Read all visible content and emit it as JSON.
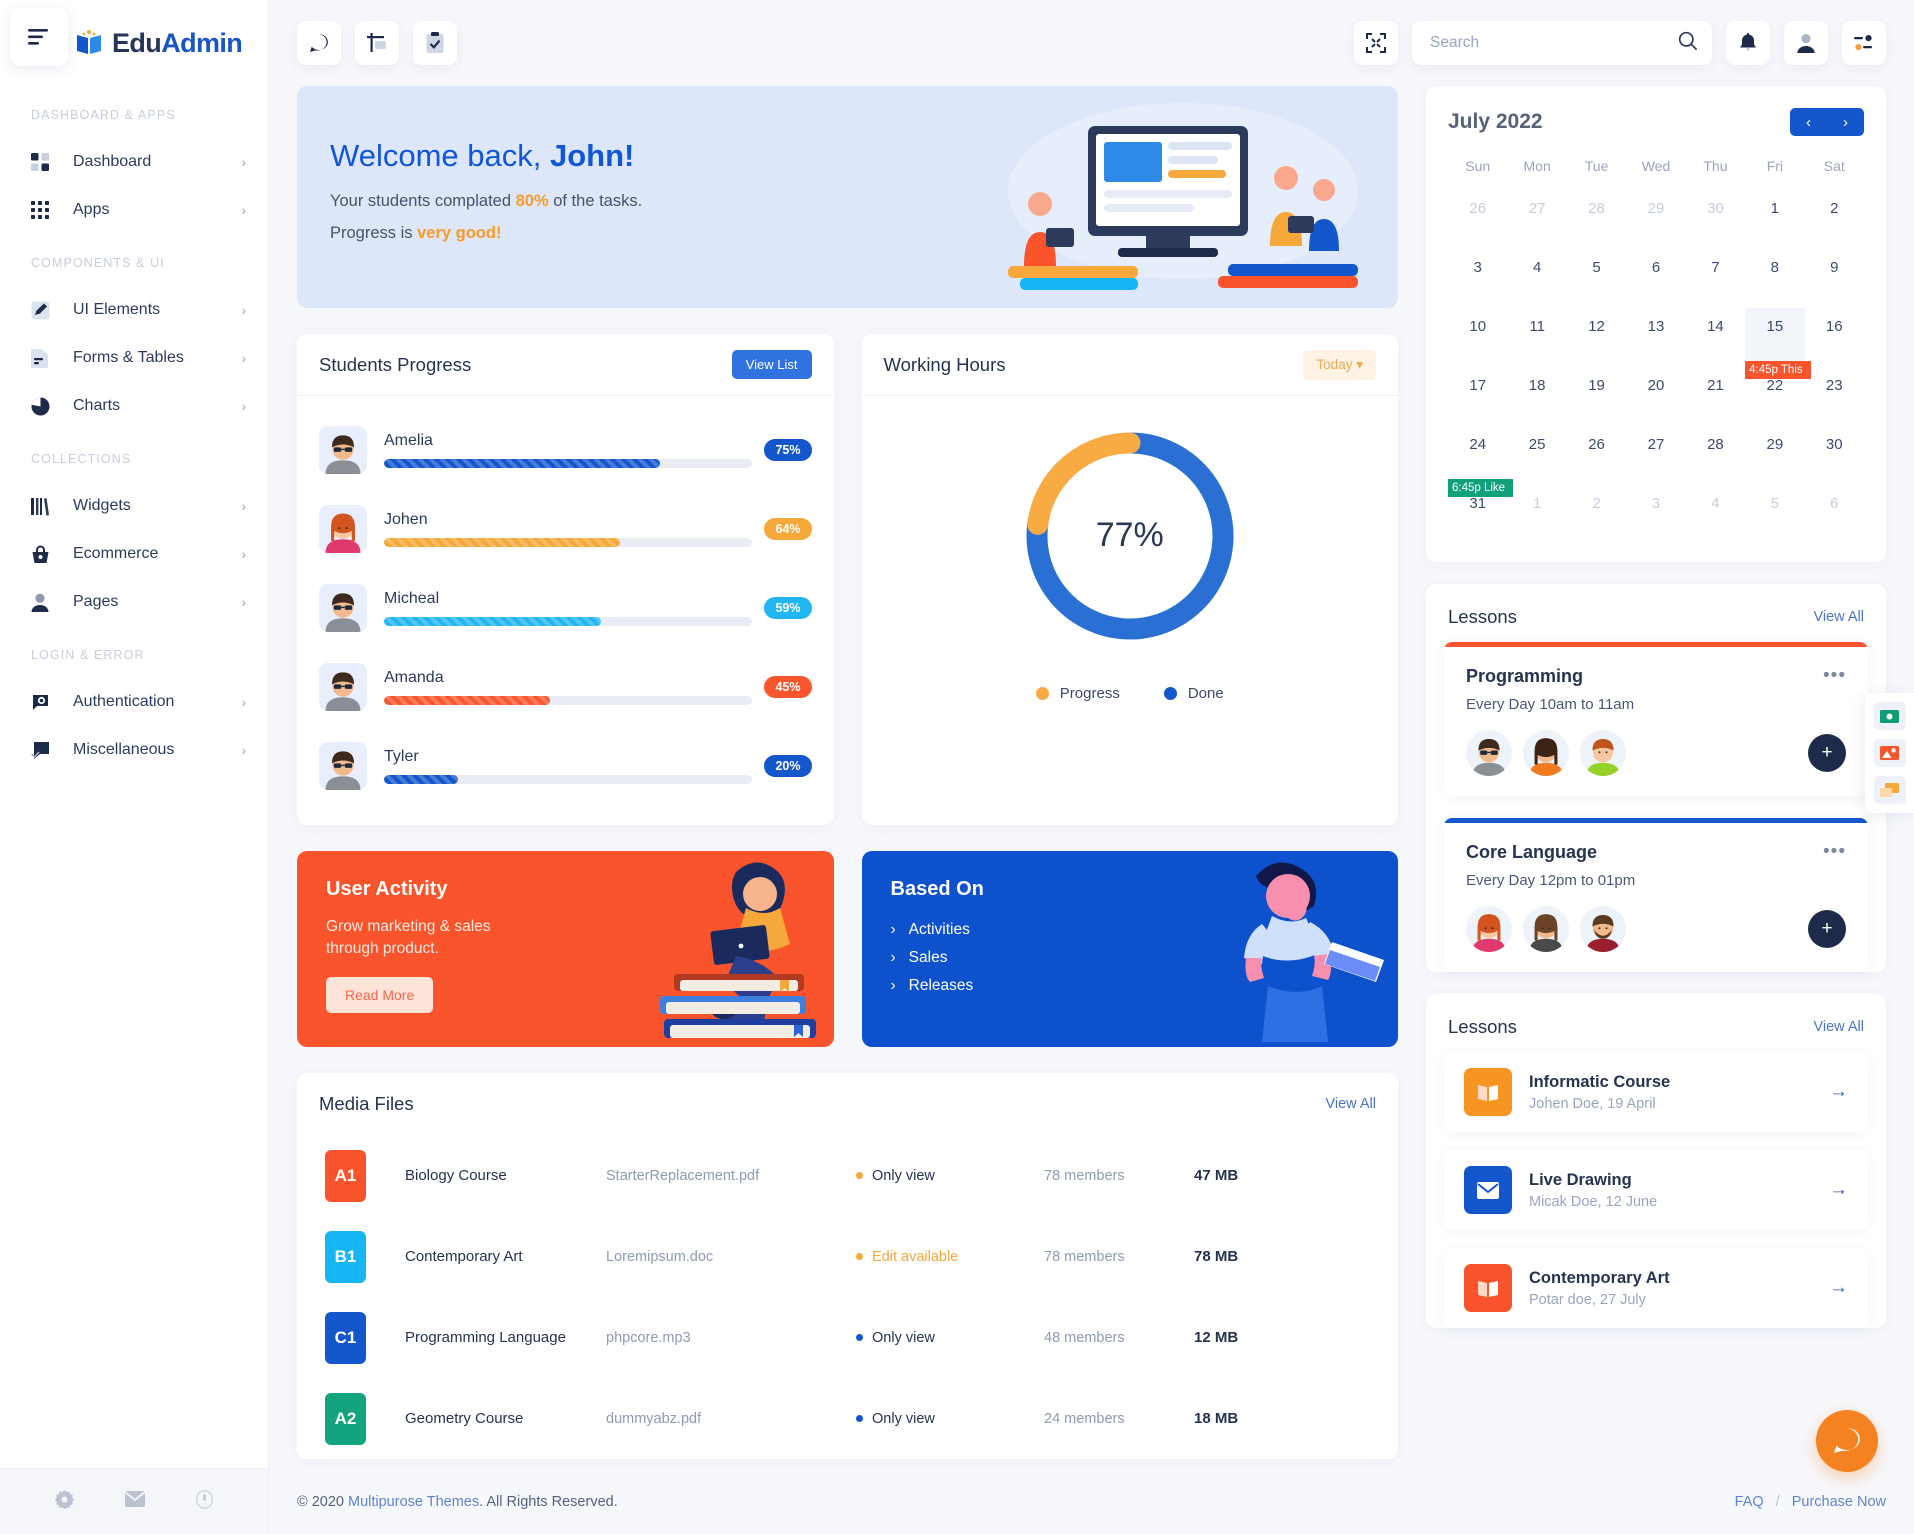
{
  "brand": {
    "name_part1": "Edu",
    "name_part2": "Admin",
    "logo_icon": "open-book-icon"
  },
  "sidebar": {
    "toggle_icon": "menu-toggle-icon",
    "groups": [
      {
        "heading": "DASHBOARD & APPS",
        "items": [
          {
            "label": "Dashboard",
            "icon": "grid-squares-icon"
          },
          {
            "label": "Apps",
            "icon": "apps-dots-icon"
          }
        ]
      },
      {
        "heading": "COMPONENTS & UI",
        "items": [
          {
            "label": "UI Elements",
            "icon": "pencil-square-icon"
          },
          {
            "label": "Forms & Tables",
            "icon": "document-icon"
          },
          {
            "label": "Charts",
            "icon": "pie-chart-icon"
          }
        ]
      },
      {
        "heading": "COLLECTIONS",
        "items": [
          {
            "label": "Widgets",
            "icon": "books-icon"
          },
          {
            "label": "Ecommerce",
            "icon": "basket-icon"
          },
          {
            "label": "Pages",
            "icon": "user-icon"
          }
        ]
      },
      {
        "heading": "LOGIN & ERROR",
        "items": [
          {
            "label": "Authentication",
            "icon": "lock-icon"
          },
          {
            "label": "Miscellaneous",
            "icon": "flag-check-icon"
          }
        ]
      }
    ],
    "footer_icons": [
      "gear-icon",
      "mail-icon",
      "power-lock-icon"
    ]
  },
  "topbar": {
    "left_icons": [
      "chat-bubble-icon",
      "layout-icon",
      "clipboard-check-icon"
    ],
    "fullscreen_icon": "fullscreen-icon",
    "search": {
      "placeholder": "Search",
      "value": "",
      "icon": "search-icon"
    },
    "right_icons": [
      "bell-icon",
      "user-avatar-icon",
      "settings-sliders-icon"
    ]
  },
  "welcome": {
    "title_prefix": "Welcome back, ",
    "title_name": "John!",
    "line1_pre": "Your students complated ",
    "line1_hl": "80%",
    "line1_post": " of the tasks.",
    "line2_pre": "Progress is ",
    "line2_hl": "very good!"
  },
  "students_progress": {
    "title": "Students Progress",
    "button": "View List",
    "rows": [
      {
        "name": "Amelia",
        "percent": 75,
        "label": "75%",
        "color": "#1457cc",
        "avatar": "man-sunglasses-avatar"
      },
      {
        "name": "Johen",
        "percent": 64,
        "label": "64%",
        "color": "#f7a83a",
        "avatar": "woman-redhair-avatar"
      },
      {
        "name": "Micheal",
        "percent": 59,
        "label": "59%",
        "color": "#22b6f2",
        "avatar": "man-sunglasses-avatar"
      },
      {
        "name": "Amanda",
        "percent": 45,
        "label": "45%",
        "color": "#f9562e",
        "avatar": "man-sunglasses-avatar"
      },
      {
        "name": "Tyler",
        "percent": 20,
        "label": "20%",
        "color": "#1457cc",
        "avatar": "man-sunglasses-avatar"
      }
    ]
  },
  "chart_data": {
    "type": "pie",
    "title": "Working Hours",
    "center_label": "77%",
    "labels": [
      "Done",
      "Progress"
    ],
    "values": [
      77,
      23
    ],
    "colors": [
      "#2a6fd4",
      "#f9ab43"
    ],
    "legend_position": "bottom",
    "donut": true,
    "legend": [
      {
        "name": "Progress",
        "color": "#f9ab43",
        "value": 23
      },
      {
        "name": "Done",
        "color": "#1457cc",
        "value": 77
      }
    ],
    "filter_label": "Today"
  },
  "user_activity": {
    "title": "User Activity",
    "subtitle": "Grow marketing & sales through product.",
    "button": "Read More",
    "bg": "#f9542b"
  },
  "based_on": {
    "title": "Based On",
    "bg": "#0d52cc",
    "items": [
      "Activities",
      "Sales",
      "Releases"
    ]
  },
  "media_files": {
    "title": "Media Files",
    "view_all": "View All",
    "rows": [
      {
        "code": "A1",
        "code_bg": "#f9542b",
        "name": "Biology Course",
        "file": "StarterReplacement.pdf",
        "permission": "Only view",
        "perm_color": "#f7a83a",
        "members": "78 members",
        "size": "47 MB"
      },
      {
        "code": "B1",
        "code_bg": "#16b6f5",
        "name": "Contemporary Art",
        "file": "Loremipsum.doc",
        "permission": "Edit available",
        "perm_color": "#f7a83a",
        "members": "78 members",
        "size": "78 MB"
      },
      {
        "code": "C1",
        "code_bg": "#1457cc",
        "name": "Programming Language",
        "file": "phpcore.mp3",
        "permission": "Only view",
        "perm_color": "#1457cc",
        "members": "48 members",
        "size": "12 MB"
      },
      {
        "code": "A2",
        "code_bg": "#13a37f",
        "name": "Geometry Course",
        "file": "dummyabz.pdf",
        "permission": "Only view",
        "perm_color": "#1457cc",
        "members": "24 members",
        "size": "18 MB"
      }
    ]
  },
  "calendar": {
    "month": "July 2022",
    "prev_icon": "chevron-left-icon",
    "next_icon": "chevron-right-icon",
    "dow": [
      "Sun",
      "Mon",
      "Tue",
      "Wed",
      "Thu",
      "Fri",
      "Sat"
    ],
    "weeks": [
      [
        {
          "d": "26",
          "mut": true
        },
        {
          "d": "27",
          "mut": true
        },
        {
          "d": "28",
          "mut": true
        },
        {
          "d": "29",
          "mut": true
        },
        {
          "d": "30",
          "mut": true
        },
        {
          "d": "1"
        },
        {
          "d": "2"
        }
      ],
      [
        {
          "d": "3"
        },
        {
          "d": "4"
        },
        {
          "d": "5"
        },
        {
          "d": "6"
        },
        {
          "d": "7"
        },
        {
          "d": "8"
        },
        {
          "d": "9"
        }
      ],
      [
        {
          "d": "10"
        },
        {
          "d": "11"
        },
        {
          "d": "12"
        },
        {
          "d": "13"
        },
        {
          "d": "14"
        },
        {
          "d": "15",
          "today": true,
          "event": "4:45p This",
          "event_bg": "#f9542b"
        },
        {
          "d": "16"
        }
      ],
      [
        {
          "d": "17"
        },
        {
          "d": "18"
        },
        {
          "d": "19"
        },
        {
          "d": "20"
        },
        {
          "d": "21"
        },
        {
          "d": "22"
        },
        {
          "d": "23"
        }
      ],
      [
        {
          "d": "24",
          "event": "6:45p Like",
          "event_bg": "#12a07a"
        },
        {
          "d": "25"
        },
        {
          "d": "26"
        },
        {
          "d": "27"
        },
        {
          "d": "28"
        },
        {
          "d": "29"
        },
        {
          "d": "30"
        }
      ],
      [
        {
          "d": "31"
        },
        {
          "d": "1",
          "mut": true
        },
        {
          "d": "2",
          "mut": true
        },
        {
          "d": "3",
          "mut": true
        },
        {
          "d": "4",
          "mut": true
        },
        {
          "d": "5",
          "mut": true
        },
        {
          "d": "6",
          "mut": true
        }
      ]
    ]
  },
  "lessons_schedule": {
    "title": "Lessons",
    "view_all": "View All",
    "cards": [
      {
        "name": "Programming",
        "time": "Every Day 10am to 11am",
        "accent": "#f9542b",
        "menu_icon": "more-dots-icon",
        "add_icon": "plus-icon",
        "faces": [
          "man-sunglasses-avatar",
          "woman-orange-avatar",
          "man-green-avatar"
        ]
      },
      {
        "name": "Core Language",
        "time": "Every Day 12pm to 01pm",
        "accent": "#1457cc",
        "menu_icon": "more-dots-icon",
        "add_icon": "plus-icon",
        "faces": [
          "woman-redhair-avatar",
          "woman-brown-avatar",
          "man-beard-avatar"
        ]
      }
    ]
  },
  "lessons_list": {
    "title": "Lessons",
    "view_all": "View All",
    "items": [
      {
        "title": "Informatic Course",
        "sub": "Johen Doe, 19 April",
        "bg": "#f79522",
        "icon": "open-book-icon",
        "arrow": "arrow-right-icon"
      },
      {
        "title": "Live Drawing",
        "sub": "Micak Doe, 12 June",
        "bg": "#1457cc",
        "icon": "envelope-icon",
        "arrow": "arrow-right-icon"
      },
      {
        "title": "Contemporary Art",
        "sub": "Potar doe, 27 July",
        "bg": "#f9542b",
        "icon": "open-book-icon",
        "arrow": "arrow-right-icon"
      }
    ]
  },
  "float_panel": {
    "icons": [
      "cash-icon",
      "image-icon",
      "chat-icon"
    ]
  },
  "chat_fab": {
    "icon": "chat-bubble-icon"
  },
  "footer": {
    "copyright_pre": "© 2020 ",
    "copyright_link": "Multipurose Themes",
    "copyright_post": ". All Rights Reserved.",
    "links": [
      "FAQ",
      "Purchase Now"
    ],
    "separator": "/"
  }
}
